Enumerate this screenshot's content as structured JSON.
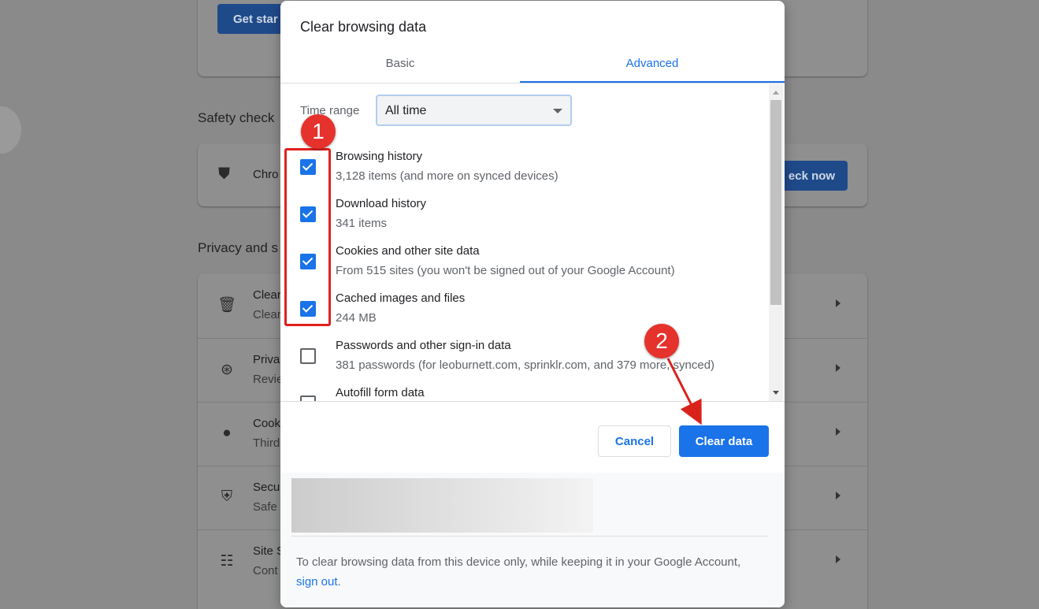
{
  "background": {
    "get_started": "Get star",
    "safety_check_heading": "Safety check",
    "chrome_partial": "Chro",
    "check_now": "eck now",
    "privacy_heading": "Privacy and s",
    "rows": [
      {
        "icon": "trash-icon",
        "t1": "Clear",
        "t2": "Clear"
      },
      {
        "icon": "compass-icon",
        "t1": "Priva",
        "t2": "Revie"
      },
      {
        "icon": "cookie-icon",
        "t1": "Cook",
        "t2": "Third"
      },
      {
        "icon": "shield-icon",
        "t1": "Secu",
        "t2": "Safe"
      },
      {
        "icon": "sliders-icon",
        "t1": "Site S",
        "t2": "Cont"
      }
    ]
  },
  "dialog": {
    "title": "Clear browsing data",
    "tabs": {
      "basic": "Basic",
      "advanced": "Advanced"
    },
    "time_range": {
      "label": "Time range",
      "value": "All time"
    },
    "items": [
      {
        "checked": true,
        "label": "Browsing history",
        "detail": "3,128 items (and more on synced devices)"
      },
      {
        "checked": true,
        "label": "Download history",
        "detail": "341 items"
      },
      {
        "checked": true,
        "label": "Cookies and other site data",
        "detail": "From 515 sites (you won't be signed out of your Google Account)"
      },
      {
        "checked": true,
        "label": "Cached images and files",
        "detail": "244 MB"
      },
      {
        "checked": false,
        "label": "Passwords and other sign-in data",
        "detail": "381 passwords (for leoburnett.com, sprinklr.com, and 379 more, synced)"
      },
      {
        "checked": false,
        "label": "Autofill form data",
        "detail": ""
      }
    ],
    "buttons": {
      "cancel": "Cancel",
      "clear": "Clear data"
    },
    "footer": {
      "note_prefix": "To clear browsing data from this device only, while keeping it in your Google Account,",
      "sign_out": "sign out",
      "note_suffix": "."
    }
  },
  "annotations": {
    "step1": "1",
    "step2": "2",
    "color": "#e5322d"
  }
}
